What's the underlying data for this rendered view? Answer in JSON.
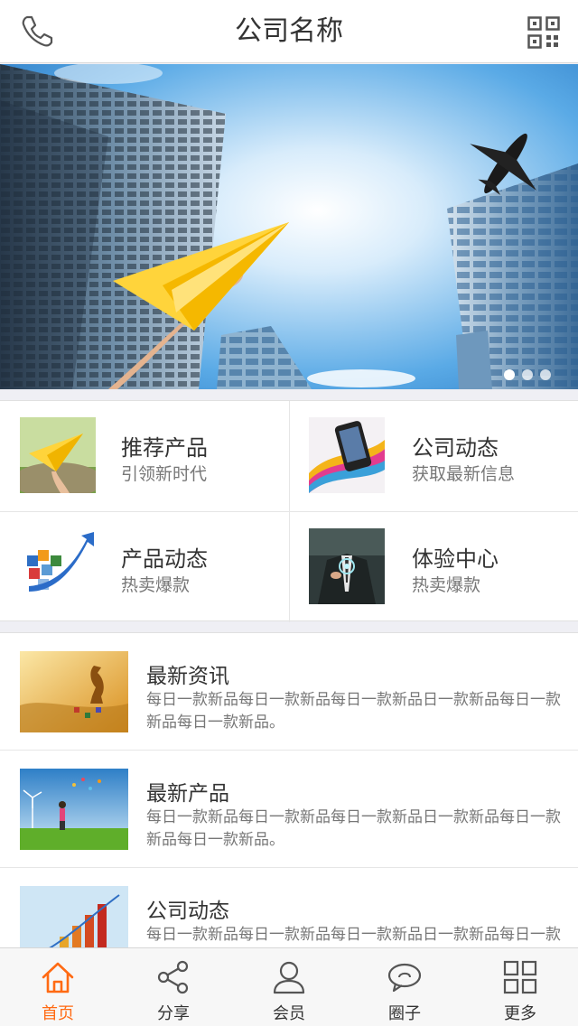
{
  "header": {
    "title": "公司名称"
  },
  "banner": {
    "slide_count": 3,
    "active_index": 0
  },
  "grid": [
    {
      "title": "推荐产品",
      "subtitle": "引领新时代",
      "icon": "paper-plane-thumb"
    },
    {
      "title": "公司动态",
      "subtitle": "获取最新信息",
      "icon": "phone-color-thumb"
    },
    {
      "title": "产品动态",
      "subtitle": "热卖爆款",
      "icon": "cubes-arrow-thumb"
    },
    {
      "title": "体验中心",
      "subtitle": "热卖爆款",
      "icon": "businessman-thumb"
    }
  ],
  "news": [
    {
      "title": "最新资讯",
      "desc": "每日一款新品每日一款新品每日一款新品日一款新品每日一款新品每日一款新品。",
      "icon": "chess-map-thumb"
    },
    {
      "title": "最新产品",
      "desc": "每日一款新品每日一款新品每日一款新品日一款新品每日一款新品每日一款新品。",
      "icon": "kite-field-thumb"
    },
    {
      "title": "公司动态",
      "desc": "每日一款新品每日一款新品每日一款新品日一款新品每日一款新品每日一款新品。",
      "icon": "bar-chart-thumb"
    }
  ],
  "tabbar": {
    "items": [
      {
        "label": "首页",
        "icon": "home-icon",
        "active": true
      },
      {
        "label": "分享",
        "icon": "share-icon",
        "active": false
      },
      {
        "label": "会员",
        "icon": "user-icon",
        "active": false
      },
      {
        "label": "圈子",
        "icon": "chat-icon",
        "active": false
      },
      {
        "label": "更多",
        "icon": "grid-icon",
        "active": false
      }
    ]
  },
  "colors": {
    "accent": "#ff6a13",
    "text": "#333333",
    "subtext": "#777777",
    "background": "#efeff4"
  }
}
